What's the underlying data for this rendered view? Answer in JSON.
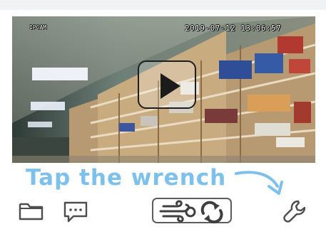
{
  "video": {
    "camera_name": "IPCAM",
    "timestamp": "2019-07-12  13:06:57",
    "state": "paused"
  },
  "annotation": {
    "text": "Tap the wrench",
    "color": "#7ec0ec"
  },
  "toolbar": {
    "icons": [
      "folder-icon",
      "message-icon",
      "wind-icon",
      "rotate-icon",
      "wrench-icon"
    ]
  },
  "colors": {
    "icon": "#4d4d4d",
    "annotation": "#7ec0ec"
  }
}
